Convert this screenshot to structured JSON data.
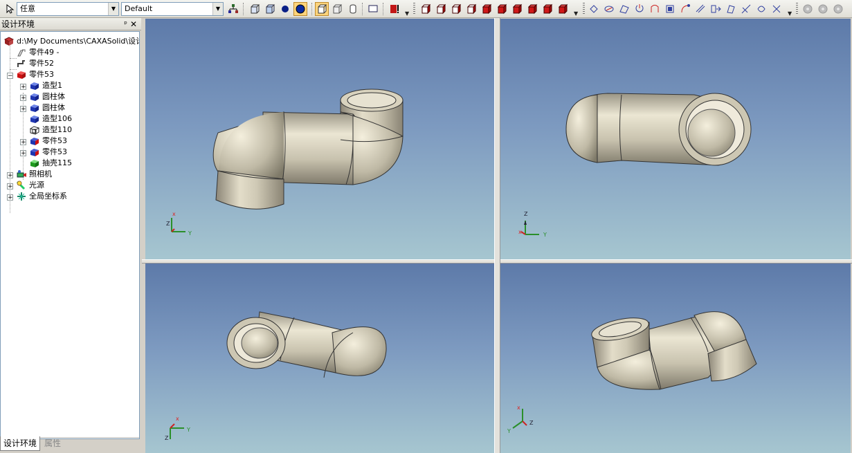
{
  "toolbar": {
    "filter_value": "任意",
    "style_value": "Default",
    "icons": [
      "select-arrow-icon",
      "tree-structure-icon",
      "box-view-icon",
      "wire-view-icon",
      "solid-sphere-icon",
      "shaded-sphere-icon",
      "render-mode-icon",
      "cube-hidden-icon",
      "cylinder-icon",
      "frame-icon",
      "warning-icon",
      "red-cube-icons",
      "feature-tools-icons",
      "disabled-gear-icons"
    ]
  },
  "panel": {
    "title": "设计环境",
    "pin": "ᵖ",
    "close": "✕",
    "tree": [
      {
        "label": "d:\\My Documents\\CAXASolid\\设计",
        "icon": "design-root-icon"
      },
      {
        "label": "零件49 -",
        "icon": "part-grey-icon"
      },
      {
        "label": "零件52",
        "icon": "part-grey-icon"
      },
      {
        "label": "零件53",
        "icon": "part-red-icon"
      },
      {
        "label": "造型1",
        "icon": "blue-block-icon"
      },
      {
        "label": "圆柱体",
        "icon": "blue-block-icon"
      },
      {
        "label": "圆柱体",
        "icon": "blue-block-icon"
      },
      {
        "label": "造型106",
        "icon": "blue-block-icon"
      },
      {
        "label": "造型110",
        "icon": "wire-block-icon"
      },
      {
        "label": "零件53",
        "icon": "part-red-icon"
      },
      {
        "label": "零件53",
        "icon": "part-red-icon"
      },
      {
        "label": "抽壳115",
        "icon": "green-block-icon"
      },
      {
        "label": "照相机",
        "icon": "camera-icon"
      },
      {
        "label": "光源",
        "icon": "light-icon"
      },
      {
        "label": "全局坐标系",
        "icon": "coordinate-icon"
      }
    ],
    "tabs": [
      "设计环境",
      "属性"
    ]
  },
  "viewports": {
    "axis_labels": {
      "x": "x",
      "y": "Y",
      "z": "Z"
    },
    "colors": {
      "background_top": "#5d7aa9",
      "background_bottom": "#a6c6d0",
      "model": "#cfc9b5"
    }
  }
}
